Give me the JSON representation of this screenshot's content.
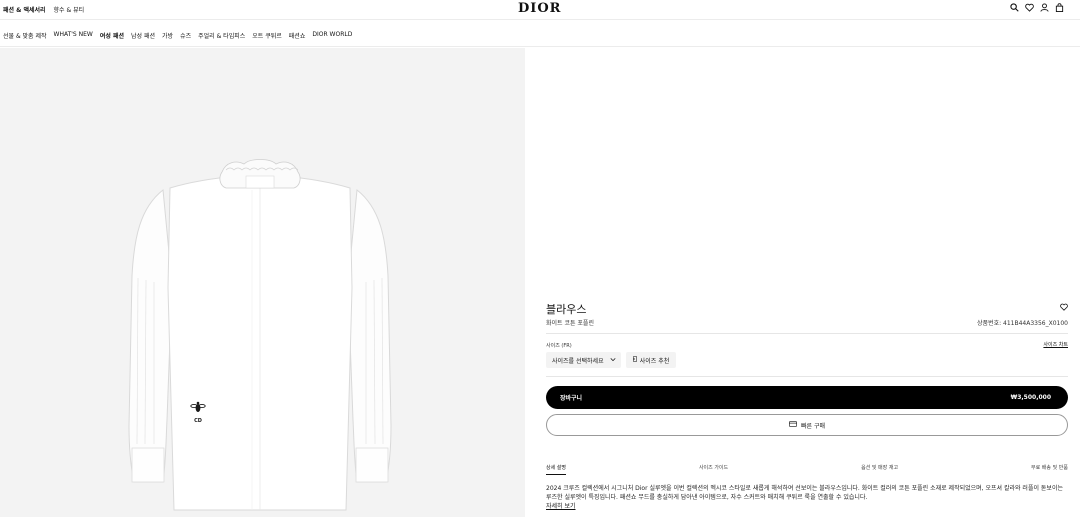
{
  "topbar": {
    "link_fashion": "패션 & 액세서리",
    "link_beauty": "향수 & 뷰티",
    "logo": "DIOR",
    "icons": [
      "search-icon",
      "heart-icon",
      "user-icon",
      "bag-icon"
    ]
  },
  "nav": {
    "items": [
      {
        "label": "선물 & 맞춤 제작",
        "active": false
      },
      {
        "label": "WHAT'S NEW",
        "active": false
      },
      {
        "label": "여성 패션",
        "active": true
      },
      {
        "label": "남성 패션",
        "active": false
      },
      {
        "label": "가방",
        "active": false
      },
      {
        "label": "슈즈",
        "active": false
      },
      {
        "label": "주얼리 & 타임피스",
        "active": false
      },
      {
        "label": "오트 쿠튀르",
        "active": false
      },
      {
        "label": "패션쇼",
        "active": false
      },
      {
        "label": "DIOR WORLD",
        "active": false
      }
    ]
  },
  "product": {
    "image_monogram": "CD",
    "title": "블라우스",
    "subtitle": "화이트 코튼 포플린",
    "reference": "상품번호: 411B44A3356_X0100",
    "size_label": "사이즈 (FR)",
    "size_chart": "사이즈 차트",
    "size_select": "사이즈를 선택하세요",
    "size_recommend": "사이즈 추천",
    "cart_label": "장바구니",
    "price": "₩3,500,000",
    "quick_buy": "빠른 구매"
  },
  "tabs": [
    "상세 설명",
    "사이즈 가이드",
    "옵션 및 매장 재고",
    "무료 배송 및 반품"
  ],
  "description": {
    "text": "2024 크루즈 컬렉션에서 시그니처 Dior 실루엣을 이번 컬렉션의 멕시코 스타일로 새롭게 해석하여 선보이는 블라우스입니다. 화이트 컬러의 코튼 포플린 소재로 제작되었으며, 오프셔 칼라와 러플이 돋보이는 루즈한 실루엣이 특징입니다. 패션쇼 무드를 충실하게 담아낸 아이템으로, 자수 스커트와 매치해 쿠튀르 룩을 연출할 수 있습니다.",
    "more": "자세히 보기"
  },
  "colors": {
    "accent": "#000000",
    "image_bg": "#f3f3f3"
  }
}
